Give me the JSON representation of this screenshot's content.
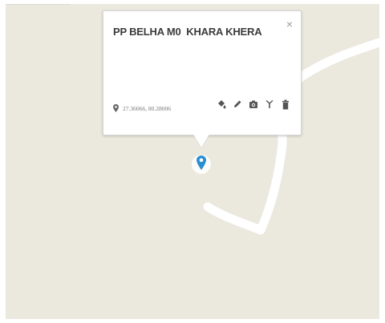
{
  "popup": {
    "title": "PP BELHA M0  KHARA KHERA",
    "close_glyph": "×",
    "coordinates": "27.36066, 80.28006",
    "tools": [
      "paint-bucket-icon",
      "pencil-icon",
      "camera-icon",
      "antenna-icon",
      "trash-icon"
    ]
  },
  "colors": {
    "map_background": "#ebe8de",
    "road": "#ffffff",
    "marker": "#2a8fd1",
    "icon": "#555555"
  }
}
